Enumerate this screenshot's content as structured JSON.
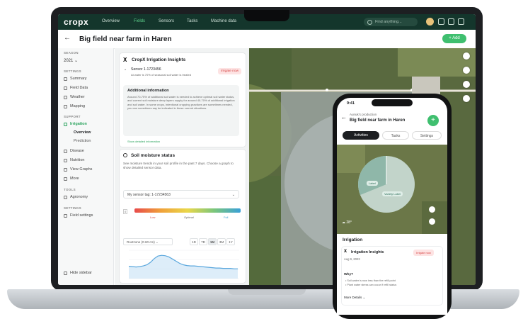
{
  "app": {
    "logo": "cropx",
    "nav": [
      "Overview",
      "Fields",
      "Sensors",
      "Tasks",
      "Machine data"
    ],
    "active_nav": "Fields",
    "search_placeholder": "Find anything..."
  },
  "header": {
    "title": "Big field near farm in Haren",
    "add_label": "+ Add"
  },
  "sidebar": {
    "season_label": "SEASON",
    "season_value": "2021",
    "settings_label": "SETTINGS",
    "items_top": [
      "Summary",
      "Field Data",
      "Weather",
      "Mapping"
    ],
    "support_label": "SUPPORT",
    "irrigation": "Irrigation",
    "irrigation_subs": [
      "Overview",
      "Prediction"
    ],
    "items_bottom": [
      "Disease",
      "Nutrition",
      "View Graphs",
      "More"
    ],
    "tools_label": "TOOLS",
    "tools": [
      "Agronomy"
    ],
    "settings2_label": "SETTINGS",
    "settings_items": [
      "Field settings"
    ],
    "footer": "Hide sidebar"
  },
  "insights": {
    "title": "CropX Irrigation Insights",
    "sensor": "Sensor 1-1723456",
    "sensor_sub": "At water is 70% of seasonal soil water is treated",
    "badge": "Irrigate now",
    "info_title": "Additional information",
    "info_text": "Around 70-75% of additional soil water is needed to achieve optimal soil water status, and current soil moisture deep layers supply for around 40-70% of additional irrigation and soil water. In some crops, intentional cropping practices are sometimes needed, you can sometimes say be indicated in these current situations.",
    "info_link": "Show detailed information"
  },
  "soil": {
    "title": "Soil moisture status",
    "desc": "See moisture trends in your soil profile in the past 7 days. Choose a graph to show detailed sensor data.",
    "select_value": "My sensor tag: 1-17234563",
    "scale_labels": [
      "Low",
      "Optimal",
      "Full"
    ],
    "depth_select": "Rootzone (0-60 cm)",
    "ranges": [
      "1D",
      "7D",
      "1M",
      "3M",
      "1Y"
    ],
    "active_range": "1M"
  },
  "phone": {
    "time": "9:41",
    "subtitle": "Aunuk's production",
    "title": "Big field near farm in Haren",
    "tabs": [
      "Activities",
      "Tasks",
      "Settings"
    ],
    "map_labels": [
      "Label",
      "Variety Label"
    ],
    "weather": "28°",
    "sheet_title": "Irrigation",
    "card_title": "Irrigation Insights",
    "card_date": "Aug 9, 2023",
    "badge": "Irrigate now",
    "why": "Why?",
    "bullets": [
      "Soil water is now less than the refill point",
      "Plant water stress can occur if refill status"
    ],
    "more": "More Details"
  },
  "chart_data": {
    "type": "line",
    "x": [
      0,
      1,
      2,
      3,
      4,
      5,
      6,
      7,
      8,
      9,
      10,
      11,
      12,
      13,
      14,
      15,
      16,
      17,
      18,
      19,
      20,
      21,
      22,
      23,
      24,
      25,
      26,
      27,
      28,
      29,
      30
    ],
    "series": [
      {
        "values": [
          34,
          33,
          32,
          33,
          35,
          38,
          45,
          55,
          62,
          64,
          63,
          60,
          54,
          48,
          42,
          38,
          36,
          35,
          35,
          34,
          33,
          32,
          31,
          30,
          29,
          29,
          28,
          28,
          28,
          27,
          27
        ]
      }
    ],
    "ylim": [
      0,
      80
    ],
    "colors": {
      "line": "#5aa7dd",
      "fill": "#cfe6f7"
    }
  }
}
